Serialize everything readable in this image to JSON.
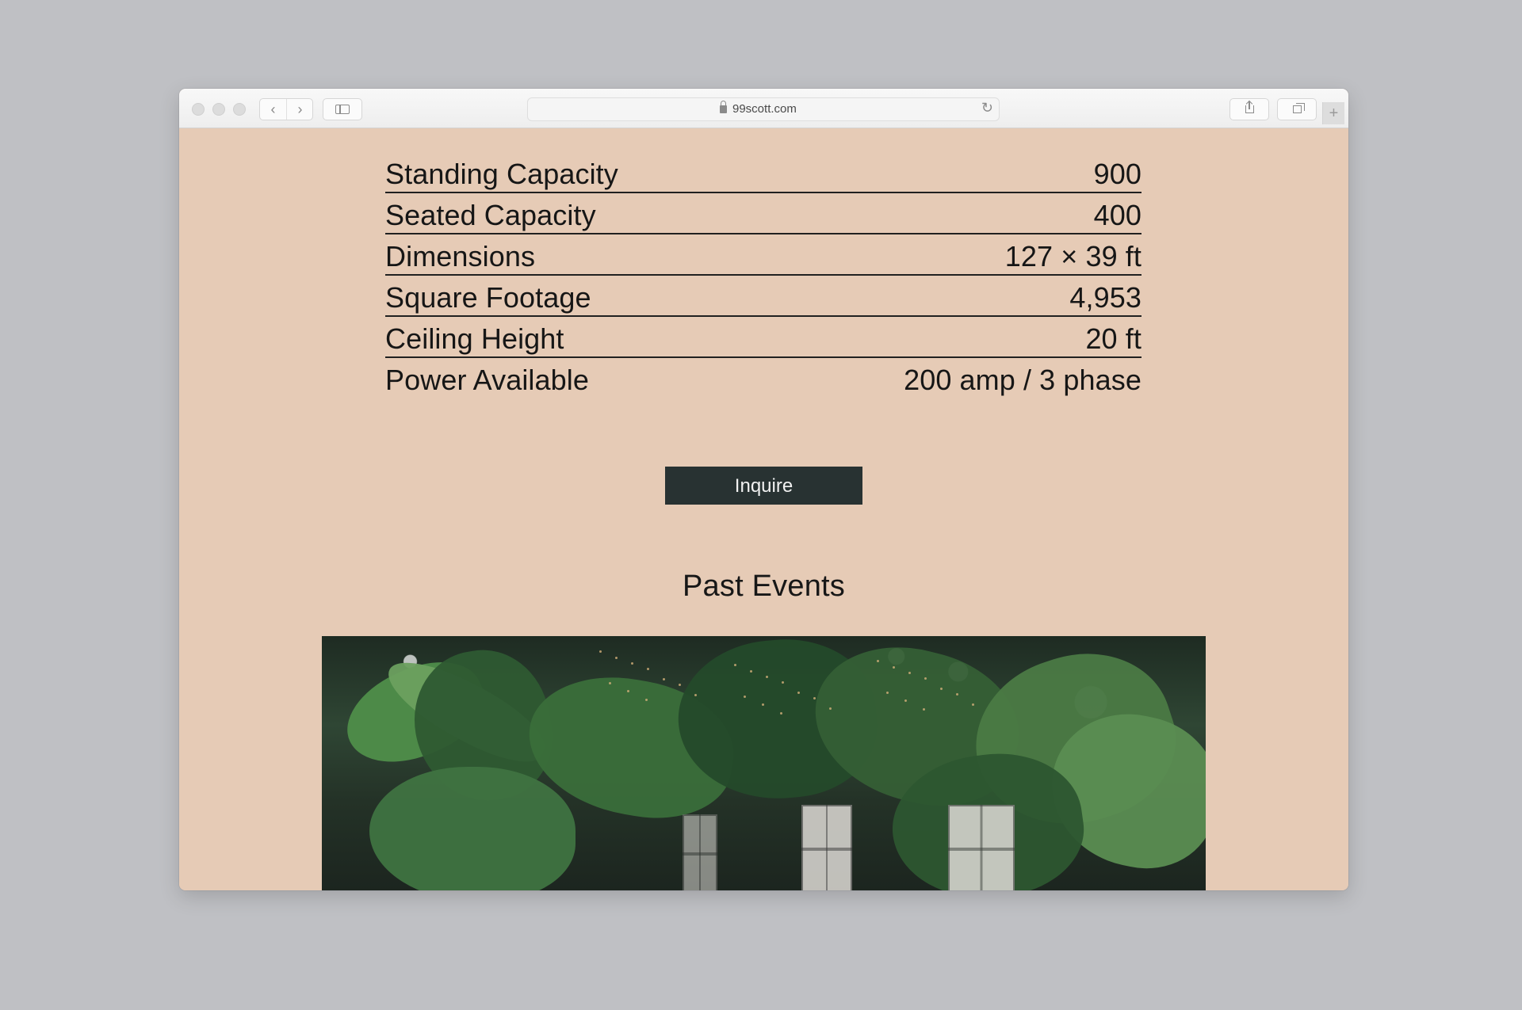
{
  "browser": {
    "url": "99scott.com"
  },
  "specs": {
    "rows": [
      {
        "label": "Standing Capacity",
        "value": "900"
      },
      {
        "label": "Seated Capacity",
        "value": "400"
      },
      {
        "label": "Dimensions",
        "value": "127 × 39 ft"
      },
      {
        "label": "Square Footage",
        "value": "4,953"
      },
      {
        "label": "Ceiling Height",
        "value": "20 ft"
      },
      {
        "label": "Power Available",
        "value": "200 amp / 3 phase"
      }
    ]
  },
  "actions": {
    "inquire_label": "Inquire"
  },
  "past_events": {
    "title": "Past Events"
  },
  "colors": {
    "page_background": "#e6cbb6",
    "button_background": "#283232",
    "text": "#161616"
  }
}
